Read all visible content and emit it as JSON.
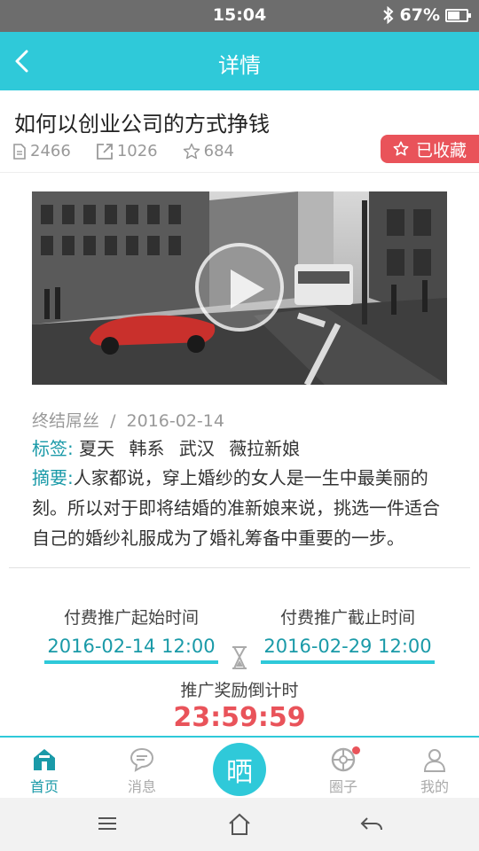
{
  "status_bar": {
    "time": "15:04",
    "battery_percent": "67%",
    "battery_level": 0.67
  },
  "header": {
    "title": "详情"
  },
  "article": {
    "title": "如何以创业公司的方式挣钱",
    "views": "2466",
    "shares": "1026",
    "favorites": "684",
    "favorited_label": "已收藏"
  },
  "info": {
    "author": "终结屌丝",
    "separator": "/",
    "date": "2016-02-14",
    "tags_label": "标签:",
    "tags": [
      "夏天",
      "韩系",
      "武汉",
      "薇拉新娘"
    ],
    "summary_label": "摘要:",
    "summary_text": "人家都说，穿上婚纱的女人是一生中最美丽的刻。所以对于即将结婚的准新娘来说，挑选一件适合自己的婚纱礼服成为了婚礼筹备中重要的一步。"
  },
  "promotion": {
    "start_label": "付费推广起始时间",
    "start_value": "2016-02-14  12:00",
    "end_label": "付费推广截止时间",
    "end_value": "2016-02-29  12:00",
    "countdown_label": "推广奖励倒计时",
    "countdown_value": "23:59:59"
  },
  "bottom_nav": {
    "home": "首页",
    "messages": "消息",
    "center": "晒",
    "circle": "圈子",
    "mine": "我的"
  },
  "colors": {
    "accent": "#2fc9d9",
    "teal_text": "#1a9aa8",
    "red": "#e9535a"
  }
}
